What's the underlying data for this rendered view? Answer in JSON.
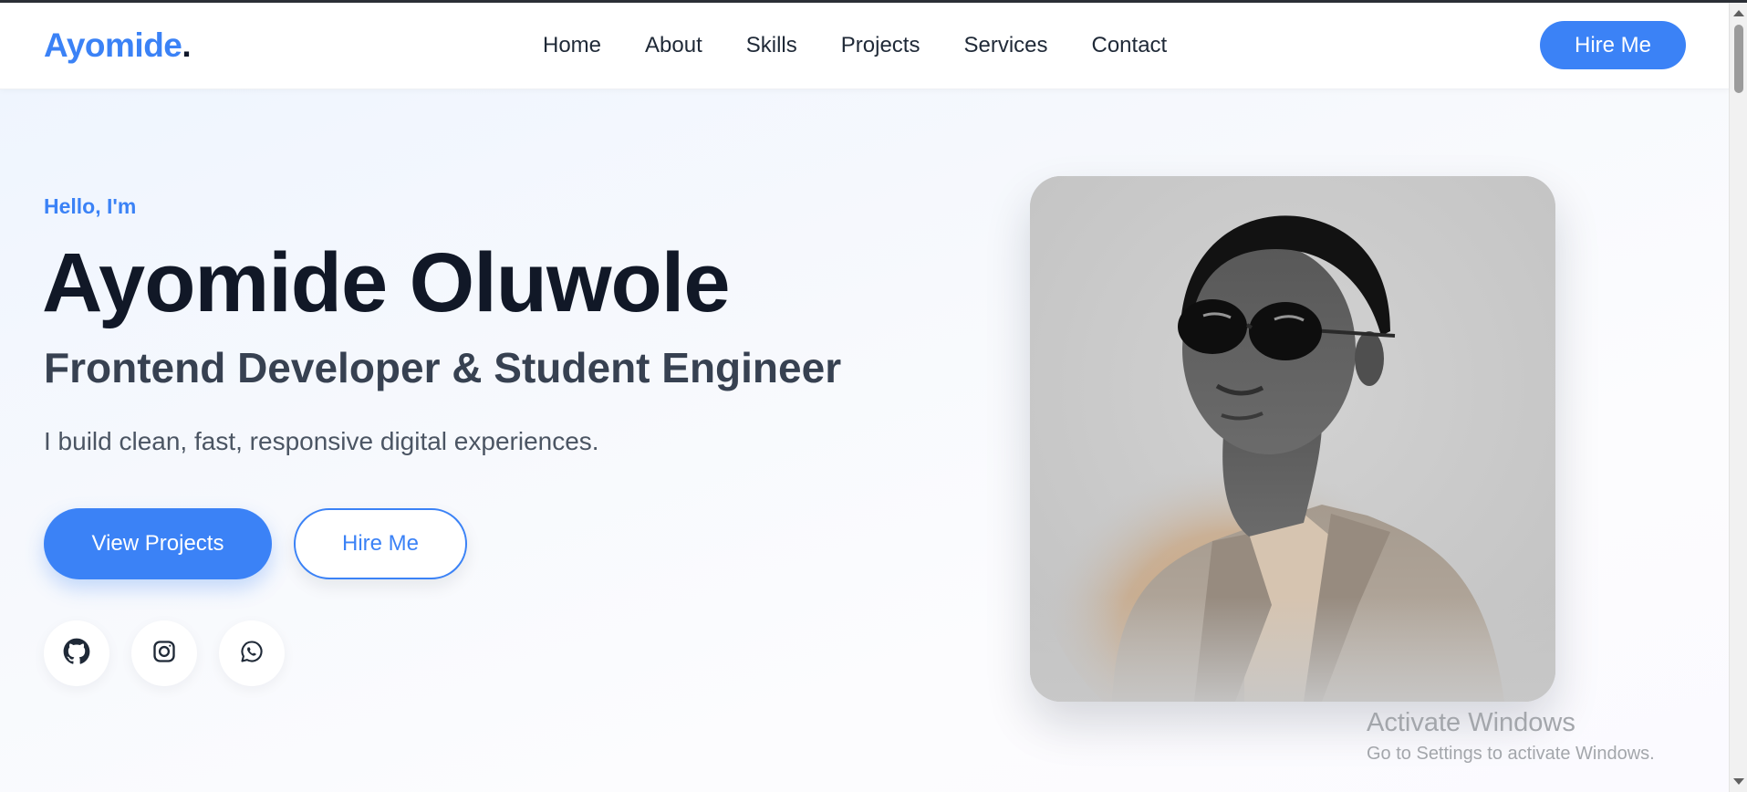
{
  "nav": {
    "logo_text": "Ayomide",
    "logo_dot": ".",
    "links": [
      "Home",
      "About",
      "Skills",
      "Projects",
      "Services",
      "Contact"
    ],
    "hire_label": "Hire Me"
  },
  "hero": {
    "greeting": "Hello, I'm",
    "name": "Ayomide Oluwole",
    "role": "Frontend Developer & Student Engineer",
    "tagline": "I build clean, fast, responsive digital experiences.",
    "primary_button": "View Projects",
    "secondary_button": "Hire Me",
    "socials": [
      {
        "icon": "github-icon"
      },
      {
        "icon": "instagram-icon"
      },
      {
        "icon": "whatsapp-icon"
      }
    ]
  },
  "watermark": {
    "title": "Activate Windows",
    "subtitle": "Go to Settings to activate Windows."
  },
  "colors": {
    "accent": "#3b82f6",
    "heading": "#111827",
    "body_text": "#4b5563"
  }
}
